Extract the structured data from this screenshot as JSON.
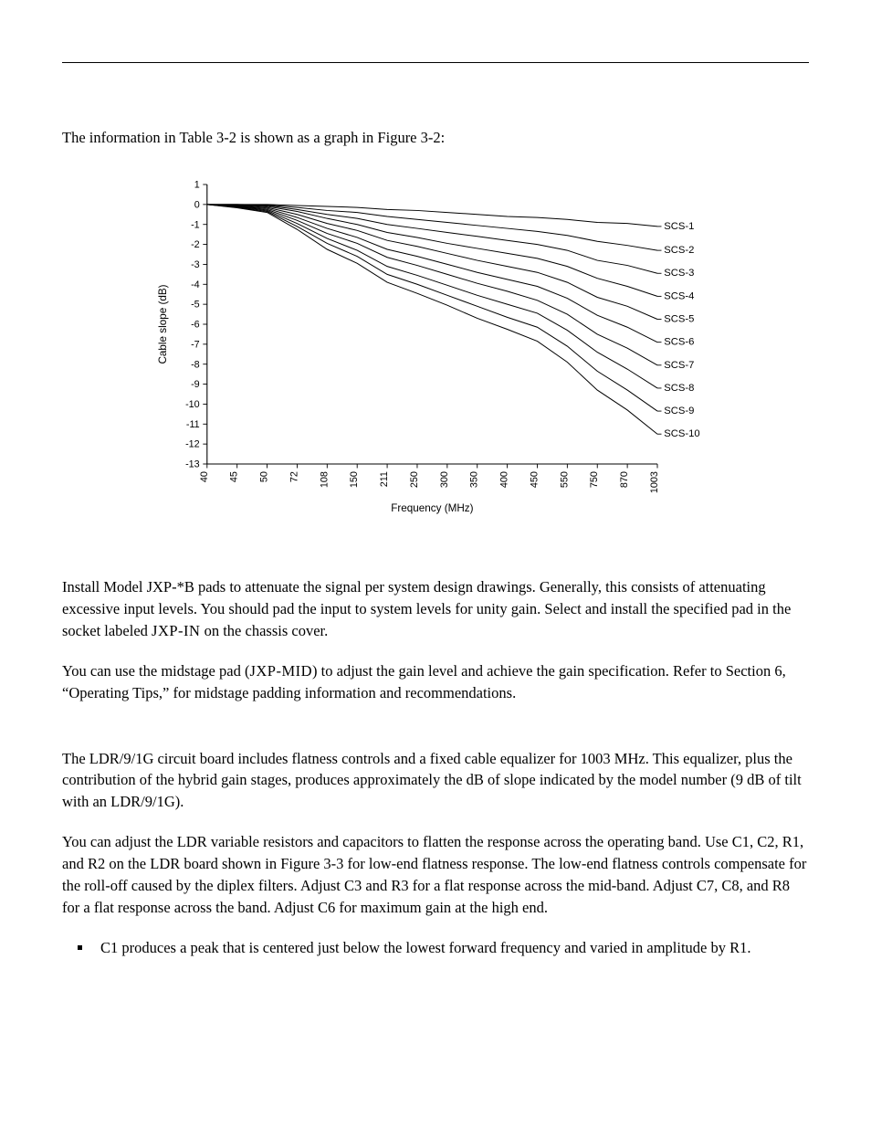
{
  "lead": "The information in Table 3-2 is shown as a graph in Figure 3-2:",
  "paragraphs": {
    "p1a": "Install Model JXP-*B pads to attenuate the signal per system design drawings. Generally, this consists of attenuating excessive input levels. You should pad the input to system levels for unity gain. Select and install the specified pad in the socket labeled ",
    "p1sc": "JXP-IN",
    "p1b": " on the chassis cover.",
    "p2a": "You can use the midstage pad (",
    "p2sc": "JXP-MID",
    "p2b": ") to adjust the gain level and achieve the gain specification. Refer to Section 6, “Operating Tips,” for midstage padding information and recommendations.",
    "p3": "The LDR/9/1G circuit board includes flatness controls and a fixed cable equalizer for 1003 MHz. This equalizer, plus the contribution of the hybrid gain stages, produces approximately the dB of slope indicated by the model number (9 dB of tilt with an LDR/9/1G).",
    "p4": "You can adjust the LDR variable resistors and capacitors to flatten the response across the operating band. Use C1, C2, R1, and R2 on the LDR board shown in Figure 3-3 for low-end flatness response. The low-end flatness controls compensate for the roll-off caused by the diplex filters. Adjust C3 and R3 for a flat response across the mid-band. Adjust C7, C8, and R8 for a flat response across the band. Adjust C6 for maximum gain at the high end.",
    "b1": "C1 produces a peak that is centered just below the lowest forward frequency and varied in amplitude by R1."
  },
  "chart_data": {
    "type": "line",
    "ylabel": "Cable slope (dB)",
    "xlabel": "Frequency (MHz)",
    "y_ticks": [
      1,
      0,
      -1,
      -2,
      -3,
      -4,
      -5,
      -6,
      -7,
      -8,
      -9,
      -10,
      -11,
      -12,
      -13
    ],
    "categories": [
      "40",
      "45",
      "50",
      "72",
      "108",
      "150",
      "211",
      "250",
      "300",
      "350",
      "400",
      "450",
      "550",
      "750",
      "870",
      "1003"
    ],
    "ylim": [
      -13,
      1
    ],
    "series": [
      {
        "name": "SCS-1",
        "values": [
          0.0,
          0.0,
          0.0,
          -0.05,
          -0.1,
          -0.15,
          -0.25,
          -0.3,
          -0.4,
          -0.5,
          -0.6,
          -0.65,
          -0.75,
          -0.9,
          -0.95,
          -1.1
        ]
      },
      {
        "name": "SCS-2",
        "values": [
          0.0,
          0.0,
          -0.02,
          -0.15,
          -0.3,
          -0.4,
          -0.6,
          -0.75,
          -0.9,
          -1.05,
          -1.2,
          -1.35,
          -1.55,
          -1.85,
          -2.05,
          -2.3
        ]
      },
      {
        "name": "SCS-3",
        "values": [
          0.0,
          0.0,
          -0.05,
          -0.25,
          -0.5,
          -0.7,
          -1.0,
          -1.2,
          -1.4,
          -1.6,
          -1.8,
          -2.0,
          -2.3,
          -2.8,
          -3.05,
          -3.45
        ]
      },
      {
        "name": "SCS-4",
        "values": [
          0.0,
          -0.02,
          -0.1,
          -0.35,
          -0.7,
          -1.0,
          -1.4,
          -1.65,
          -1.95,
          -2.2,
          -2.45,
          -2.7,
          -3.1,
          -3.7,
          -4.1,
          -4.6
        ]
      },
      {
        "name": "SCS-5",
        "values": [
          0.0,
          -0.05,
          -0.15,
          -0.5,
          -0.95,
          -1.3,
          -1.8,
          -2.1,
          -2.45,
          -2.8,
          -3.1,
          -3.4,
          -3.9,
          -4.65,
          -5.1,
          -5.75
        ]
      },
      {
        "name": "SCS-6",
        "values": [
          0.0,
          -0.08,
          -0.2,
          -0.65,
          -1.2,
          -1.65,
          -2.25,
          -2.6,
          -3.0,
          -3.4,
          -3.75,
          -4.1,
          -4.7,
          -5.55,
          -6.15,
          -6.9
        ]
      },
      {
        "name": "SCS-7",
        "values": [
          0.0,
          -0.1,
          -0.25,
          -0.8,
          -1.45,
          -1.95,
          -2.65,
          -3.05,
          -3.5,
          -3.95,
          -4.35,
          -4.8,
          -5.5,
          -6.5,
          -7.2,
          -8.05
        ]
      },
      {
        "name": "SCS-8",
        "values": [
          0.0,
          -0.12,
          -0.3,
          -0.95,
          -1.7,
          -2.3,
          -3.1,
          -3.55,
          -4.05,
          -4.55,
          -5.0,
          -5.45,
          -6.3,
          -7.4,
          -8.25,
          -9.2
        ]
      },
      {
        "name": "SCS-9",
        "values": [
          0.0,
          -0.15,
          -0.35,
          -1.1,
          -1.95,
          -2.6,
          -3.5,
          -4.0,
          -4.55,
          -5.1,
          -5.65,
          -6.15,
          -7.1,
          -8.35,
          -9.3,
          -10.35
        ]
      },
      {
        "name": "SCS-10",
        "values": [
          0.0,
          -0.17,
          -0.4,
          -1.25,
          -2.25,
          -2.95,
          -3.9,
          -4.45,
          -5.05,
          -5.7,
          -6.25,
          -6.85,
          -7.9,
          -9.3,
          -10.3,
          -11.5
        ]
      }
    ]
  }
}
